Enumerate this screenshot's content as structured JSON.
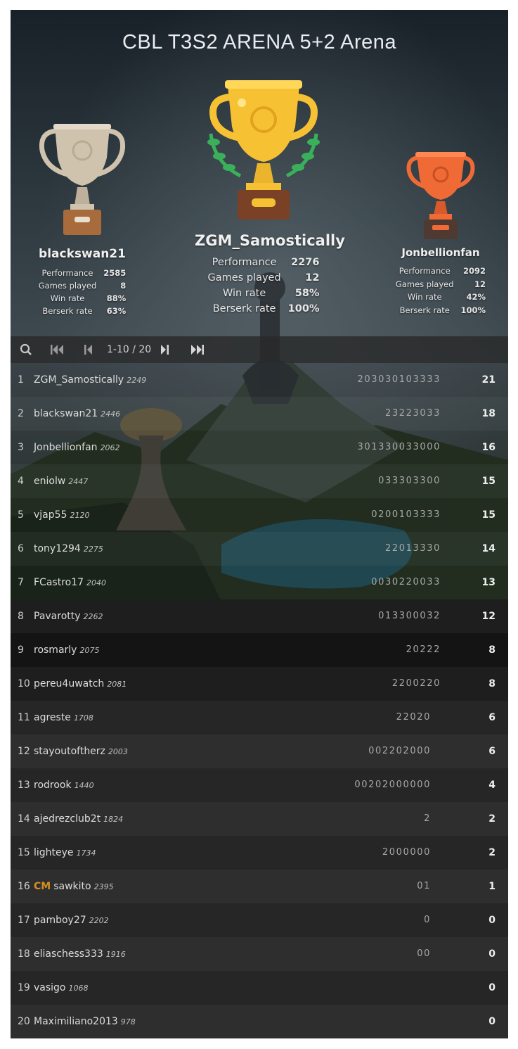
{
  "tournament": {
    "title": "CBL T3S2 ARENA 5+2 Arena"
  },
  "podium": [
    {
      "place": 2,
      "name": "blackswan21",
      "performance": "2585",
      "games_played": "8",
      "win_rate": "88%",
      "berserk_rate": "63%",
      "trophy_color": "#cfc3ae"
    },
    {
      "place": 1,
      "name": "ZGM_Samostically",
      "performance": "2276",
      "games_played": "12",
      "win_rate": "58%",
      "berserk_rate": "100%",
      "trophy_color": "#f6c233"
    },
    {
      "place": 3,
      "name": "Jonbellionfan",
      "performance": "2092",
      "games_played": "12",
      "win_rate": "42%",
      "berserk_rate": "100%",
      "trophy_color": "#f06a35"
    }
  ],
  "stat_labels": {
    "performance": "Performance",
    "games_played": "Games played",
    "win_rate": "Win rate",
    "berserk_rate": "Berserk rate"
  },
  "pager": {
    "text": "1-10 / 20",
    "icons": [
      "search-icon",
      "first-page-icon",
      "previous-page-icon",
      "next-page-icon",
      "last-page-icon"
    ]
  },
  "standings": [
    {
      "rank": "1",
      "title": "",
      "name": "ZGM_Samostically",
      "rating": "2249",
      "sheet": "203030103333",
      "score": "21"
    },
    {
      "rank": "2",
      "title": "",
      "name": "blackswan21",
      "rating": "2446",
      "sheet": "23223033",
      "score": "18"
    },
    {
      "rank": "3",
      "title": "",
      "name": "Jonbellionfan",
      "rating": "2062",
      "sheet": "301330033000",
      "score": "16"
    },
    {
      "rank": "4",
      "title": "",
      "name": "eniolw",
      "rating": "2447",
      "sheet": "033303300",
      "score": "15"
    },
    {
      "rank": "5",
      "title": "",
      "name": "vjap55",
      "rating": "2120",
      "sheet": "0200103333",
      "score": "15"
    },
    {
      "rank": "6",
      "title": "",
      "name": "tony1294",
      "rating": "2275",
      "sheet": "22013330",
      "score": "14"
    },
    {
      "rank": "7",
      "title": "",
      "name": "FCastro17",
      "rating": "2040",
      "sheet": "0030220033",
      "score": "13"
    },
    {
      "rank": "8",
      "title": "",
      "name": "Pavarotty",
      "rating": "2262",
      "sheet": "013300032",
      "score": "12"
    },
    {
      "rank": "9",
      "title": "",
      "name": "rosmarly",
      "rating": "2075",
      "sheet": "20222",
      "score": "8"
    },
    {
      "rank": "10",
      "title": "",
      "name": "pereu4uwatch",
      "rating": "2081",
      "sheet": "2200220",
      "score": "8"
    },
    {
      "rank": "11",
      "title": "",
      "name": "agreste",
      "rating": "1708",
      "sheet": "22020",
      "score": "6"
    },
    {
      "rank": "12",
      "title": "",
      "name": "stayoutoftherz",
      "rating": "2003",
      "sheet": "002202000",
      "score": "6"
    },
    {
      "rank": "13",
      "title": "",
      "name": "rodrook",
      "rating": "1440",
      "sheet": "00202000000",
      "score": "4"
    },
    {
      "rank": "14",
      "title": "",
      "name": "ajedrezclub2t",
      "rating": "1824",
      "sheet": "2",
      "score": "2"
    },
    {
      "rank": "15",
      "title": "",
      "name": "lighteye",
      "rating": "1734",
      "sheet": "2000000",
      "score": "2"
    },
    {
      "rank": "16",
      "title": "CM",
      "name": "sawkito",
      "rating": "2395",
      "sheet": "01",
      "score": "1"
    },
    {
      "rank": "17",
      "title": "",
      "name": "pamboy27",
      "rating": "2202",
      "sheet": "0",
      "score": "0"
    },
    {
      "rank": "18",
      "title": "",
      "name": "eliaschess333",
      "rating": "1916",
      "sheet": "00",
      "score": "0"
    },
    {
      "rank": "19",
      "title": "",
      "name": "vasigo",
      "rating": "1068",
      "sheet": "",
      "score": "0"
    },
    {
      "rank": "20",
      "title": "",
      "name": "Maximiliano2013",
      "rating": "978",
      "sheet": "",
      "score": "0"
    }
  ]
}
